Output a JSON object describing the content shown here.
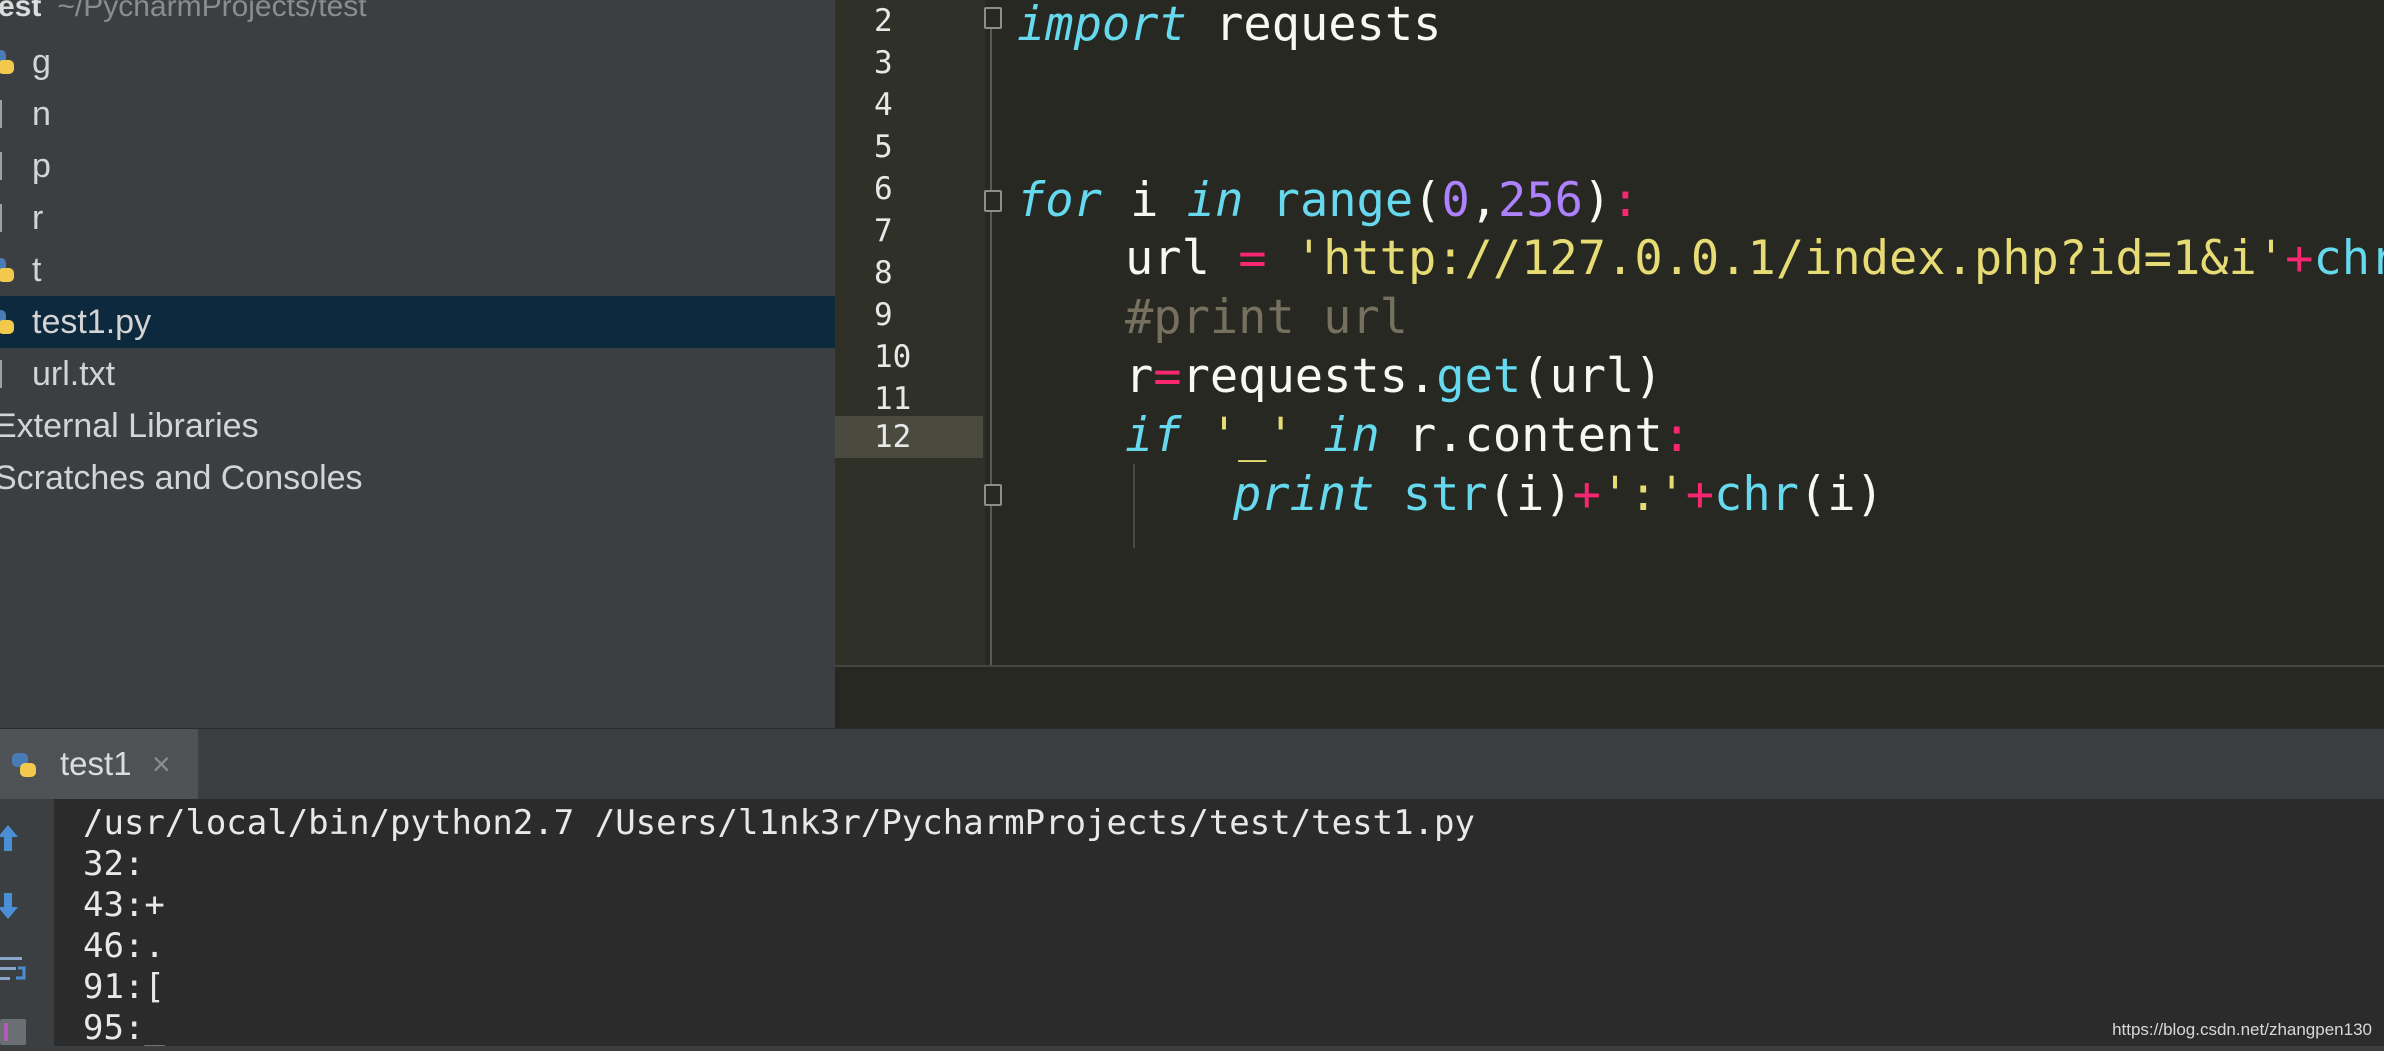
{
  "project": {
    "root_name": "test",
    "root_path": "~/PycharmProjects/test",
    "items": [
      {
        "label": "g",
        "icon": "python-file-icon"
      },
      {
        "label": "n",
        "icon": "text-file-icon"
      },
      {
        "label": "p",
        "icon": "text-file-icon"
      },
      {
        "label": "r",
        "icon": "text-file-icon"
      },
      {
        "label": "t",
        "icon": "python-file-icon"
      },
      {
        "label": "test1.py",
        "icon": "python-file-icon",
        "selected": true
      },
      {
        "label": "url.txt",
        "icon": "text-file-icon"
      },
      {
        "label": "External Libraries"
      },
      {
        "label": "Scratches and Consoles"
      }
    ]
  },
  "editor": {
    "line_numbers": [
      "2",
      "3",
      "4",
      "5",
      "6",
      "7",
      "8",
      "9",
      "10",
      "11",
      "12"
    ],
    "current_line": "12",
    "code": {
      "l1": {
        "kw": "import",
        "rest": " requests"
      },
      "l2": {
        "kw1": "for",
        "a": " i ",
        "kw2": "in",
        "b": " ",
        "fn": "range",
        "p1": "(",
        "n1": "0",
        "c": ",",
        "n2": "256",
        "p2": ")",
        "colon": ":"
      },
      "l3": {
        "a": "url ",
        "eq": "=",
        "sp": " ",
        "str": "'http://127.0.0.1/index.php?id=1&i'",
        "plus": "+",
        "fn": "chr",
        "p": "("
      },
      "l4": {
        "cmt": "#print url"
      },
      "l5": {
        "a": "r",
        "eq": "=",
        "b": "requests.",
        "fn": "get",
        "c": "(url)"
      },
      "l6": {
        "kw1": "if",
        "sp1": " ",
        "str": "'_'",
        "sp2": " ",
        "kw2": "in",
        "rest": " r.content",
        "colon": ":"
      },
      "l7": {
        "kw": "print",
        "sp": " ",
        "fn1": "str",
        "a": "(i)",
        "plus1": "+",
        "str": "':'",
        "plus2": "+",
        "fn2": "chr",
        "b": "(i)"
      }
    }
  },
  "run": {
    "tab_label": "test1",
    "close_glyph": "×",
    "lines": [
      "/usr/local/bin/python2.7 /Users/l1nk3r/PycharmProjects/test/test1.py",
      "32:",
      "43:+",
      "46:.",
      "91:[",
      "95:_"
    ]
  },
  "watermark": "https://blog.csdn.net/zhangpen130",
  "colors": {
    "panel": "#3c3f41",
    "editor_bg": "#272822",
    "selection": "#0d293e",
    "keyword": "#66d9ef",
    "string": "#e6db74",
    "number": "#ae81ff",
    "operator": "#f92672",
    "comment": "#75715e"
  }
}
